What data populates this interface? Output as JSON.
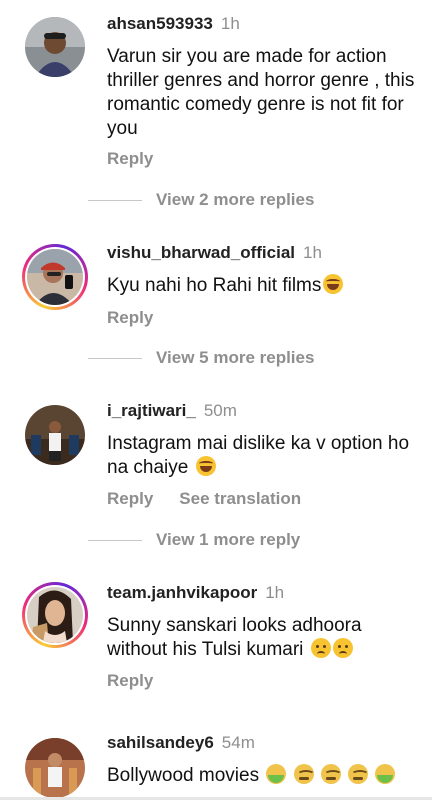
{
  "comments": [
    {
      "username": "ahsan593933",
      "time": "1h",
      "text": "Varun sir you are made for action thriller genres and horror genre , this romantic comedy genre is not fit for you",
      "reply_label": "Reply",
      "more_replies": "View 2 more replies"
    },
    {
      "username": "vishu_bharwad_official",
      "time": "1h",
      "text": "Kyu nahi ho Rahi hit films",
      "reply_label": "Reply",
      "more_replies": "View 5 more replies"
    },
    {
      "username": "i_rajtiwari_",
      "time": "50m",
      "text": "Instagram mai dislike ka v option ho na chaiye",
      "reply_label": "Reply",
      "translate_label": "See translation",
      "more_replies": "View 1 more reply"
    },
    {
      "username": "team.janhvikapoor",
      "time": "1h",
      "text": "Sunny sanskari looks adhoora without his Tulsi kumari",
      "reply_label": "Reply"
    },
    {
      "username": "sahilsandey6",
      "time": "54m",
      "text": "Bollywood movies"
    }
  ],
  "icons": {
    "laugh": "face-with-tears-of-joy-icon",
    "sad": "pleading-face-icon",
    "sick": "vomiting-face-icon",
    "nauseated": "nauseated-face-icon"
  }
}
